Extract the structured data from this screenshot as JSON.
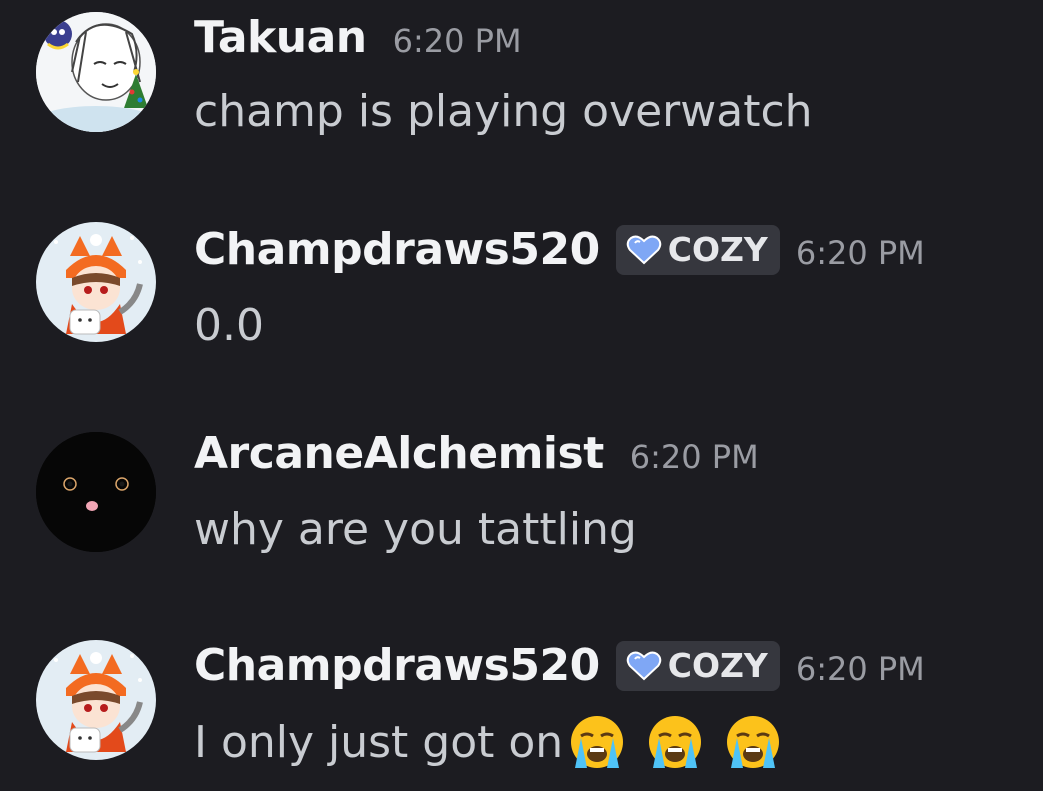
{
  "messages": [
    {
      "username": "Takuan",
      "time": "6:20 PM",
      "text": "champ is playing overwatch",
      "tag": null
    },
    {
      "username": "Champdraws520",
      "time": "6:20 PM",
      "text": "0.0",
      "tag": "COZY"
    },
    {
      "username": "ArcaneAlchemist",
      "time": "6:20 PM",
      "text": "why are you tattling",
      "tag": null
    },
    {
      "username": "Champdraws520",
      "time": "6:20 PM",
      "text": "I only just got on",
      "tag": "COZY",
      "emojis": [
        "loudly-crying-face",
        "loudly-crying-face",
        "loudly-crying-face"
      ]
    }
  ],
  "colors": {
    "background": "#1c1c21",
    "username": "#f2f3f5",
    "timestamp": "#9a9ca3",
    "message_text": "#c9ccd1",
    "tag_background": "#36373e",
    "tag_heart": "#7fa7f5"
  }
}
